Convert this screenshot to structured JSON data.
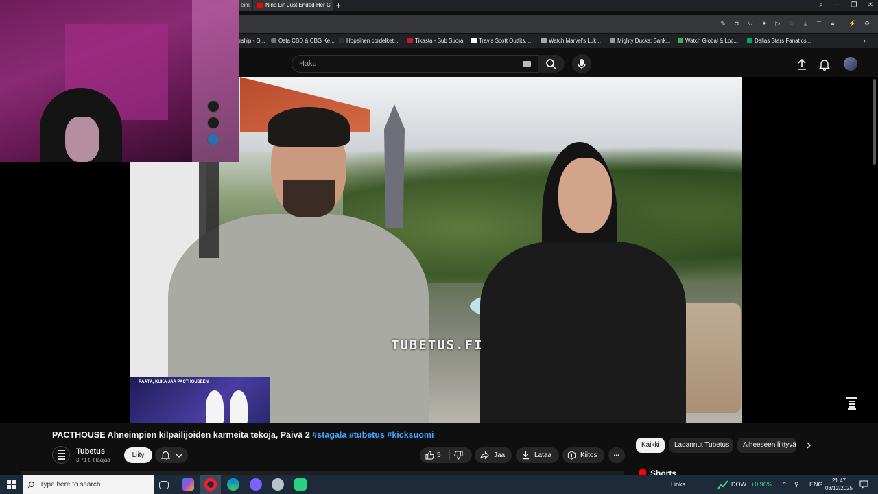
{
  "browser": {
    "tabs": [
      {
        "label": "eim"
      },
      {
        "label": "Nina Lin Just Ended Her C"
      }
    ],
    "new_tab": "+",
    "window_controls": [
      "—",
      "❐",
      "✕"
    ]
  },
  "bookmarks": [
    {
      "label": "rship - G..."
    },
    {
      "label": "Osta CBD & CBG Ke..."
    },
    {
      "label": "Hopeinen cordelket..."
    },
    {
      "label": "Tikasta - Sub Suora"
    },
    {
      "label": "Travis Scott Outfits,..."
    },
    {
      "label": "Watch Marvel's Luk..."
    },
    {
      "label": "Mighty Ducks: Bank..."
    },
    {
      "label": "Watch Global & Loc..."
    },
    {
      "label": "Dallas Stars Fanatics..."
    }
  ],
  "youtube": {
    "search_placeholder": "Haku",
    "video": {
      "watermark": "TUBETUS.FI",
      "thumb_caption": "PÄÄTÄ, KUKA JÄÄ PACTHOUSEEN"
    },
    "title_prefix": "PACTHOUSE Ahneimpien kilpailijoiden karmeita tekoja, Päivä 2",
    "hashtags": [
      "#stagala",
      "#tubetus",
      "#kicksuomi"
    ],
    "channel": {
      "name": "Tubetus",
      "subs": "3,71 t. tilaajaa"
    },
    "join_label": "Liity",
    "actions": {
      "likes": "5",
      "share": "Jaa",
      "download": "Lataa",
      "thanks": "Kiitos",
      "more": "•••"
    },
    "chips": [
      {
        "label": "Kaikki",
        "selected": true
      },
      {
        "label": "Ladannut Tubetus",
        "selected": false
      },
      {
        "label": "Aiheeseen liittyvä",
        "selected": false
      }
    ],
    "shorts_label": "Shorts"
  },
  "taskbar": {
    "search_placeholder": "Type here to search",
    "stock": {
      "name": "DOW",
      "change": "+0,96%"
    },
    "links": "Links",
    "lang": "ENG",
    "time": "21.47",
    "date": "03/12/2025"
  },
  "colors": {
    "accent_link": "#3ea6ff",
    "youtube_red": "#ff0000",
    "stock_up": "#3ddc84"
  }
}
